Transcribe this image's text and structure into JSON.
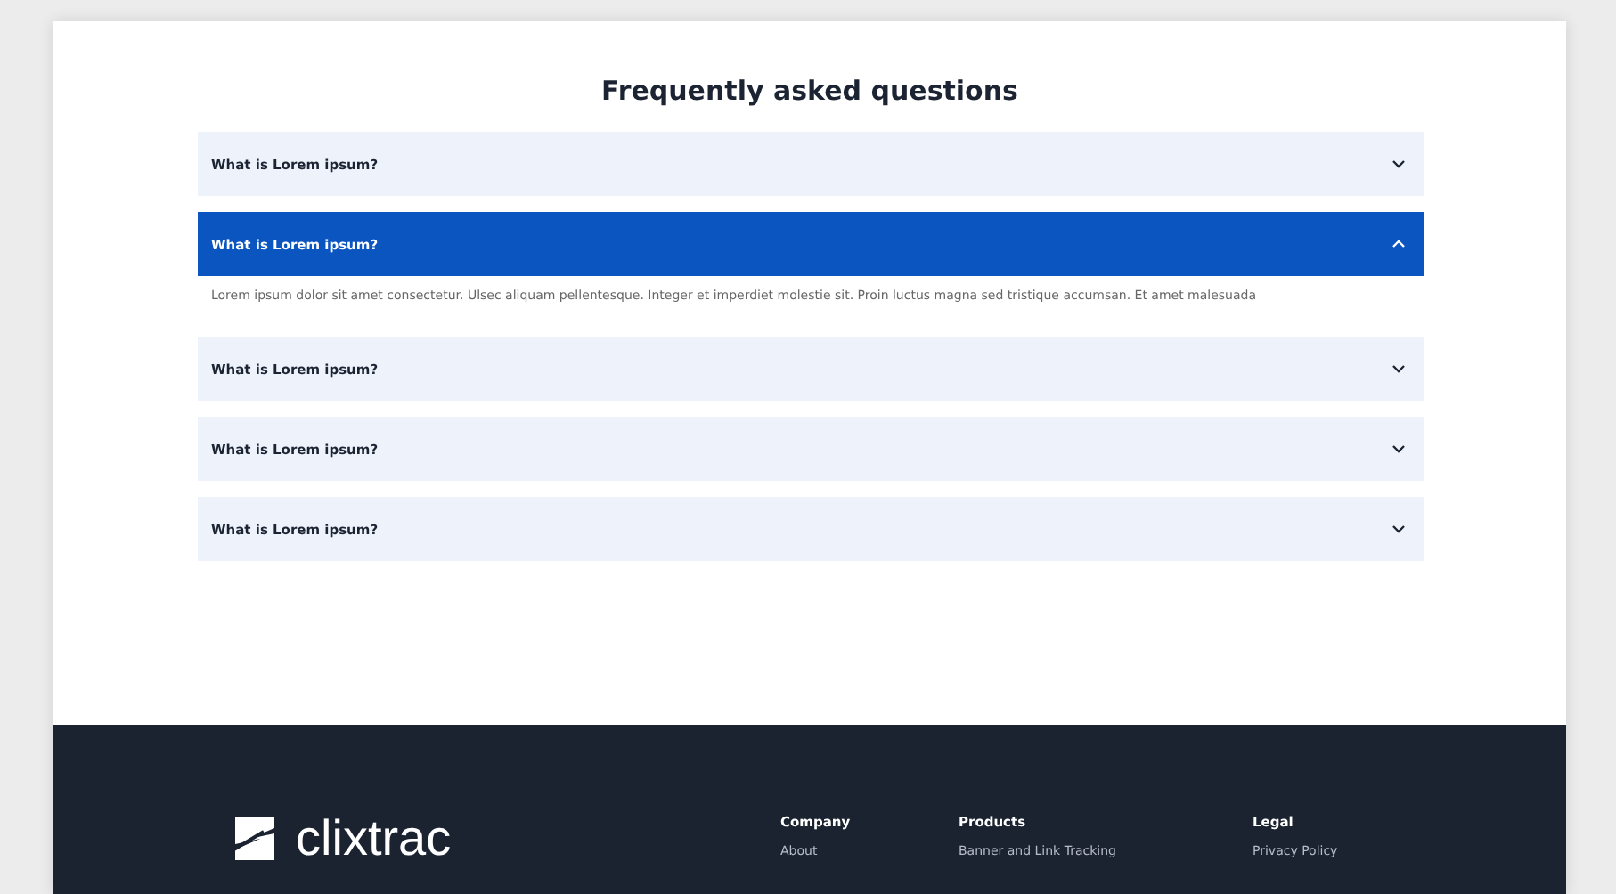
{
  "faq": {
    "title": "Frequently asked questions",
    "items": [
      {
        "question": "What is Lorem ipsum?",
        "expanded": false
      },
      {
        "question": "What is Lorem ipsum?",
        "expanded": true,
        "answer": "Lorem ipsum dolor sit amet consectetur. Ulsec aliquam pellentesque. Integer et imperdiet molestie sit. Proin luctus magna sed tristique accumsan. Et amet malesuada"
      },
      {
        "question": "What is Lorem ipsum?",
        "expanded": false
      },
      {
        "question": "What is Lorem ipsum?",
        "expanded": false
      },
      {
        "question": "What is Lorem ipsum?",
        "expanded": false
      }
    ]
  },
  "footer": {
    "logo": "clixtrac",
    "columns": [
      {
        "heading": "Company",
        "links": [
          "About"
        ]
      },
      {
        "heading": "Products",
        "links": [
          "Banner and Link Tracking"
        ]
      },
      {
        "heading": "Legal",
        "links": [
          "Privacy Policy"
        ]
      }
    ]
  }
}
